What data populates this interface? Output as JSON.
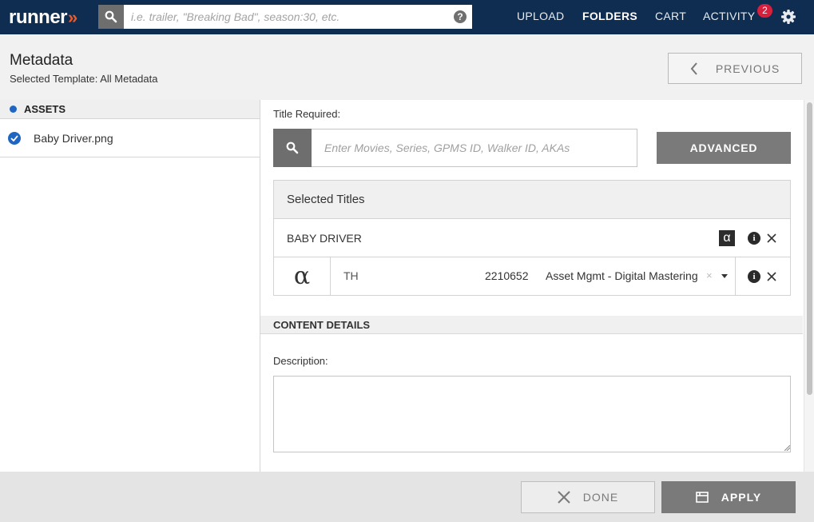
{
  "app": {
    "logo_text": "runner",
    "logo_chevrons": "»",
    "brand_colors": {
      "navbar": "#0f2d50",
      "accent": "#ec5a2a",
      "link_blue": "#1e66c1",
      "badge_red": "#d6203e"
    }
  },
  "topbar": {
    "search_placeholder": "i.e. trailer, \"Breaking Bad\", season:30, etc.",
    "help_label": "?",
    "nav": {
      "upload": "UPLOAD",
      "folders": "FOLDERS",
      "cart": "CART",
      "activity": "ACTIVITY"
    },
    "activity_badge": "2",
    "icons": [
      "search-icon",
      "help-icon",
      "gear-icon"
    ]
  },
  "header": {
    "title": "Metadata",
    "subtitle": "Selected Template: All Metadata",
    "previous_label": "PREVIOUS"
  },
  "assets": {
    "heading": "ASSETS",
    "items": [
      {
        "name": "Baby Driver.png",
        "checked": true
      }
    ]
  },
  "form": {
    "title_label": "Title Required:",
    "title_placeholder": "Enter Movies, Series, GPMS ID, Walker ID, AKAs",
    "advanced_label": "ADVANCED",
    "selected_titles": {
      "heading": "Selected Titles",
      "title": "BABY DRIVER",
      "alpha_symbol": "α",
      "info_glyph": "i",
      "mapping": {
        "code": "TH",
        "number": "2210652",
        "department": "Asset Mgmt - Digital Mastering",
        "clear_glyph": "×"
      }
    },
    "content_details_heading": "CONTENT DETAILS",
    "description_label": "Description:",
    "description_value": ""
  },
  "footer": {
    "done_label": "DONE",
    "apply_label": "APPLY"
  }
}
